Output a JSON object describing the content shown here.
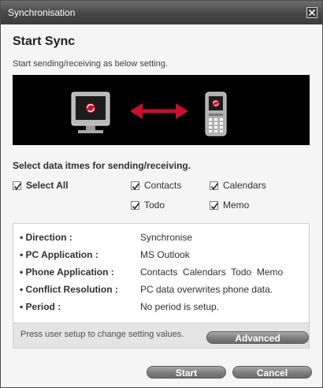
{
  "window": {
    "title": "Synchronisation"
  },
  "heading": "Start Sync",
  "subtext": "Start sending/receiving as below setting.",
  "select_label": "Select data itmes for sending/receiving.",
  "checkboxes": {
    "select_all": {
      "label": "Select All",
      "checked": true
    },
    "contacts": {
      "label": "Contacts",
      "checked": true
    },
    "calendars": {
      "label": "Calendars",
      "checked": true
    },
    "todo": {
      "label": "Todo",
      "checked": true
    },
    "memo": {
      "label": "Memo",
      "checked": true
    }
  },
  "settings": [
    {
      "label": "Direction :",
      "value": "Synchronise"
    },
    {
      "label": "PC Application :",
      "value": "MS Outlook"
    },
    {
      "label": "Phone Application :",
      "value": "Contacts  Calendars  Todo  Memo"
    },
    {
      "label": "Conflict Resolution :",
      "value": "PC data overwrites phone data."
    },
    {
      "label": "Period :",
      "value": "No period is setup."
    }
  ],
  "bullet": "•",
  "hint": "Press user setup to change setting values.",
  "buttons": {
    "advanced": "Advanced",
    "start": "Start",
    "cancel": "Cancel"
  },
  "colors": {
    "banner": "#000000",
    "accent_red": "#c8102e",
    "button": "#8a8a8a"
  }
}
